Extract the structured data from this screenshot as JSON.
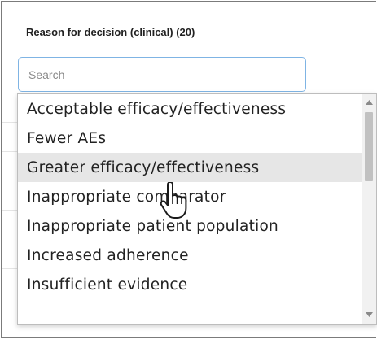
{
  "filter": {
    "title": "Reason for decision (clinical) (20)",
    "search_placeholder": "Search",
    "search_value": ""
  },
  "dropdown": {
    "options": [
      "Acceptable efficacy/effectiveness",
      "Fewer AEs",
      "Greater efficacy/effectiveness",
      "Inappropriate comparator",
      "Inappropriate patient population",
      "Increased adherence",
      "Insufficient evidence"
    ],
    "highlighted_index": 2
  },
  "icons": {
    "scroll_up": "chevron-up-icon",
    "scroll_down": "chevron-down-icon",
    "cursor": "hand-pointer-icon"
  },
  "colors": {
    "input_border": "#7fb4e4",
    "highlight": "#e6e6e6",
    "scroll_thumb": "#c1c1c1"
  }
}
